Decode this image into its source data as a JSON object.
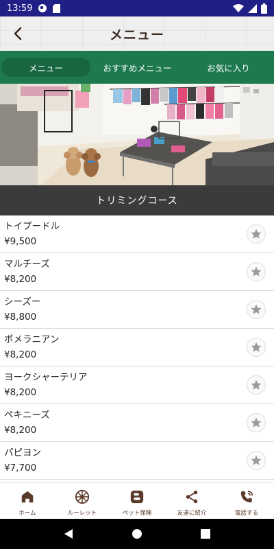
{
  "status_bar": {
    "time": "13:59"
  },
  "header": {
    "title": "メニュー"
  },
  "tabs": [
    {
      "label": "メニュー",
      "active": true
    },
    {
      "label": "おすすめメニュー",
      "active": false
    },
    {
      "label": "お気に入り",
      "active": false
    }
  ],
  "section": {
    "title": "トリミングコース"
  },
  "items": [
    {
      "name": "トイプードル",
      "price": "¥9,500"
    },
    {
      "name": "マルチーズ",
      "price": "¥8,200"
    },
    {
      "name": "シーズー",
      "price": "¥8,800"
    },
    {
      "name": "ポメラニアン",
      "price": "¥8,200"
    },
    {
      "name": "ヨークシャーテリア",
      "price": "¥8,200"
    },
    {
      "name": "ペキニーズ",
      "price": "¥8,200"
    },
    {
      "name": "パピヨン",
      "price": "¥7,700"
    }
  ],
  "bottom_nav": [
    {
      "label": "ホーム",
      "icon": "home-icon"
    },
    {
      "label": "ルーレット",
      "icon": "roulette-icon"
    },
    {
      "label": "ペット保険",
      "icon": "blog-icon"
    },
    {
      "label": "友達に紹介",
      "icon": "share-icon"
    },
    {
      "label": "電話する",
      "icon": "phone-icon"
    }
  ],
  "colors": {
    "status_bar": "#1f1f86",
    "tab_bar": "#1e7a4e",
    "tab_active": "#176640",
    "section_header": "#3b3b3b",
    "nav_icon": "#5a3a2a",
    "star": "#9a9a9a"
  }
}
